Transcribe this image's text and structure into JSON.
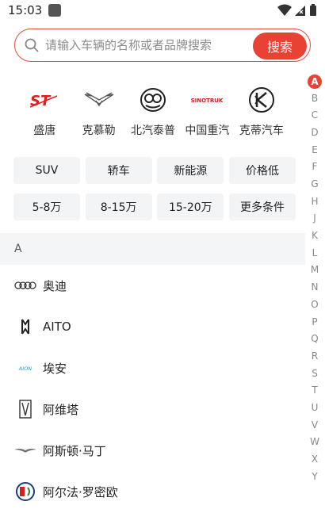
{
  "status_bar": {
    "time": "15:03"
  },
  "search": {
    "placeholder": "请输入车辆的名称或者品牌搜索",
    "button_label": "搜索"
  },
  "hot_brands": [
    {
      "name": "盛唐",
      "logo": "st-logo"
    },
    {
      "name": "克慕勒",
      "logo": "wing-logo"
    },
    {
      "name": "北汽泰普",
      "logo": "ring-logo"
    },
    {
      "name": "中国重汽",
      "logo": "sinotruk-logo",
      "logo_text": "SINOTRUK"
    },
    {
      "name": "克蒂汽车",
      "logo": "k-logo"
    }
  ],
  "filters": {
    "row1": [
      "SUV",
      "轿车",
      "新能源",
      "价格低"
    ],
    "row2": [
      "5-8万",
      "8-15万",
      "15-20万",
      "更多条件"
    ]
  },
  "section": {
    "letter": "A"
  },
  "brand_list": [
    {
      "name": "奥迪",
      "logo": "audi-logo"
    },
    {
      "name": "AITO",
      "logo": "aito-logo"
    },
    {
      "name": "埃安",
      "logo": "aion-logo",
      "logo_text": "AION"
    },
    {
      "name": "阿维塔",
      "logo": "avatr-logo"
    },
    {
      "name": "阿斯顿·马丁",
      "logo": "aston-martin-logo"
    },
    {
      "name": "阿尔法·罗密欧",
      "logo": "alfa-romeo-logo"
    }
  ],
  "index_letters": [
    "A",
    "B",
    "C",
    "D",
    "E",
    "F",
    "G",
    "H",
    "J",
    "K",
    "L",
    "M",
    "N",
    "O",
    "P",
    "Q",
    "R",
    "S",
    "T",
    "U",
    "V",
    "W",
    "X",
    "Y"
  ],
  "active_index": "A",
  "colors": {
    "accent": "#e94235",
    "chip_bg": "#f3f4f6",
    "section_bg": "#f4f5f7"
  }
}
